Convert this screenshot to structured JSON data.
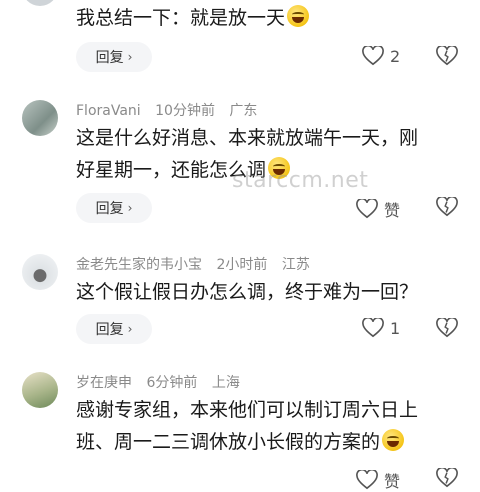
{
  "comments": [
    {
      "username": "",
      "time": "",
      "location": "",
      "text": "我总结一下：就是放一天",
      "has_emoji": true,
      "reply_label": "回复",
      "like_count": "2"
    },
    {
      "username": "FloraVani",
      "time": "10分钟前",
      "location": "广东",
      "text_line1": "这是什么好消息、本来就放端午一天，刚",
      "text_line2": "好星期一，还能怎么调",
      "has_emoji": true,
      "reply_label": "回复",
      "like_count": "赞"
    },
    {
      "username": "金老先生家的韦小宝",
      "time": "2小时前",
      "location": "江苏",
      "text": "这个假让假日办怎么调，终于难为一回？",
      "reply_label": "回复",
      "like_count": "1"
    },
    {
      "username": "岁在庚申",
      "time": "6分钟前",
      "location": "上海",
      "text_line1": "感谢专家组，本来他们可以制订周六日上",
      "text_line2": "班、周一二三调休放小长假的方案的",
      "has_emoji": true,
      "like_count": "赞"
    }
  ],
  "watermark": "starccm.net",
  "colors": {
    "meta_text": "#8a8a8a",
    "reply_bg": "#f4f5f7",
    "icon": "#555555"
  },
  "icons": [
    "heart-outline-icon",
    "broken-heart-icon",
    "chevron-right-icon",
    "laughing-emoji-icon"
  ]
}
